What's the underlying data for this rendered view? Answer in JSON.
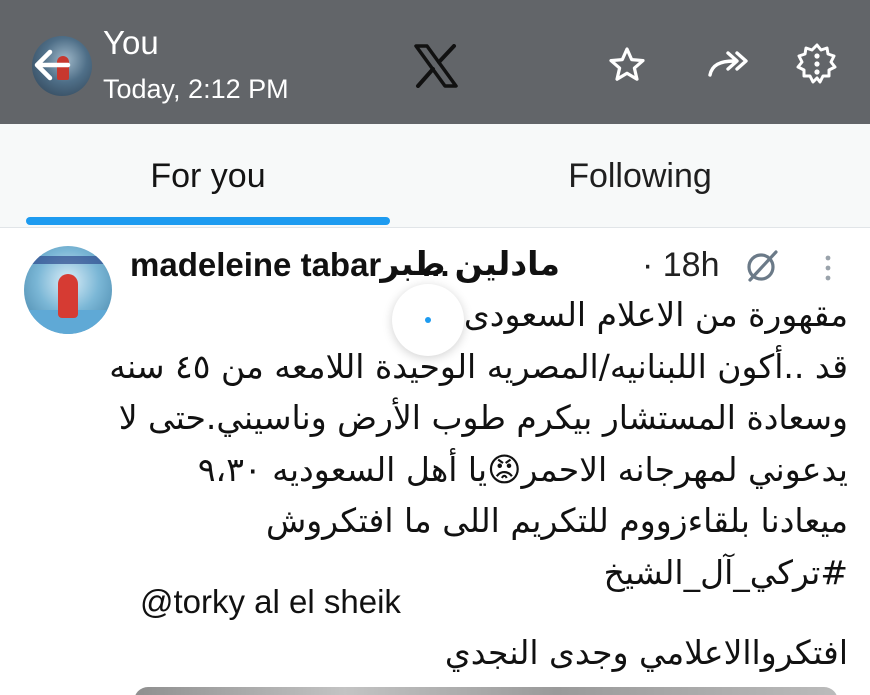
{
  "viewer": {
    "name": "You",
    "timestamp": "Today, 2:12 PM",
    "icons": [
      "back-arrow-icon",
      "x-logo-icon",
      "star-icon",
      "forward-icon",
      "settings-icon"
    ]
  },
  "tabs": [
    {
      "label": "For you",
      "active": true
    },
    {
      "label": "Following",
      "active": false
    }
  ],
  "post": {
    "author_name": "madeleine tabar",
    "author_ellipsis": "...",
    "author_arabic": "مادلين طبر",
    "time": "· 18h",
    "lines": [
      "مقهورة من الاعلام السعودى",
      "قد ..أكون اللبنانيه/المصريه الوحيدة اللامعه من ٤٥ سنه",
      "وسعادة المستشار بيكرم طوب الأرض وناسيني.حتى لا",
      "يدعوني لمهرجانه الاحمر😡يا أهل السعوديه ٩،٣٠",
      "ميعادنا بلقاءزووم للتكريم اللى ما افتكروش",
      "#تركي_آل_الشيخ"
    ],
    "mention": "@torky al el sheik",
    "last_line": "افتكرواالاعلامي وجدى النجدي"
  },
  "colors": {
    "topbar": "#626569",
    "accent": "#1d9bf0",
    "tabs_bg": "#f7f9f9",
    "text": "#111111"
  }
}
